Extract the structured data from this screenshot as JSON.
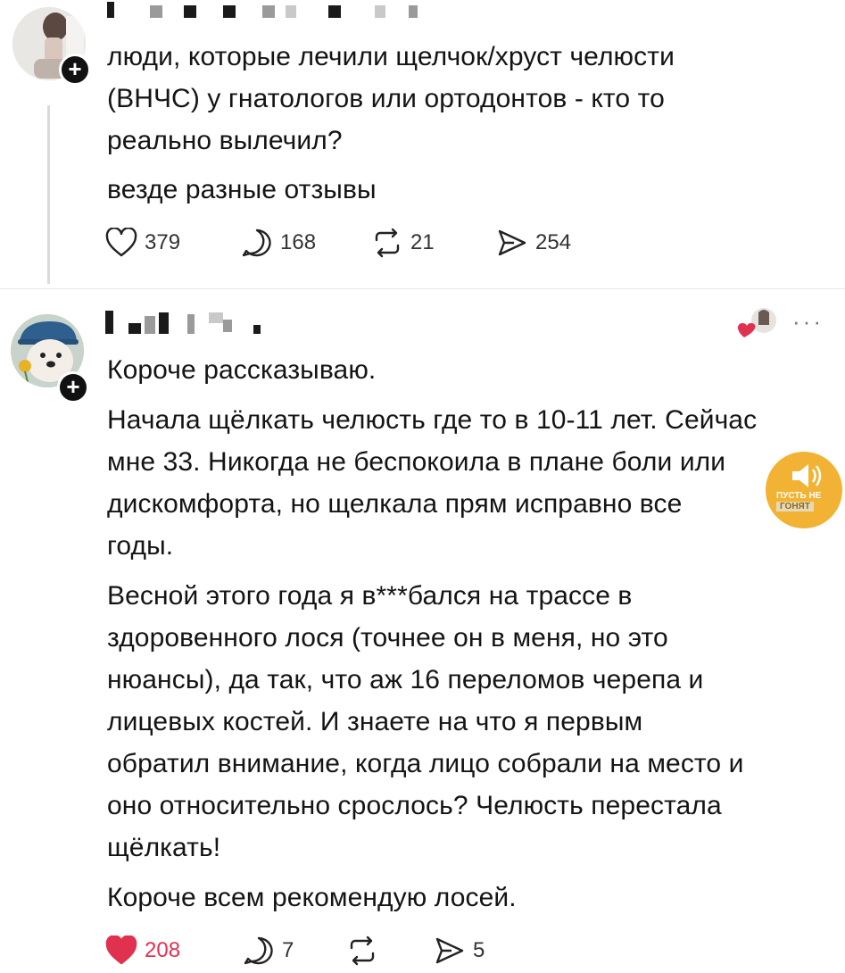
{
  "post": {
    "text_lines": [
      "люди, которые лечили щелчок/хруст челюсти",
      "(ВНЧС) у гнатологов или ортодонтов - кто то",
      "реально вылечил?"
    ],
    "subtext": "везде разные отзывы",
    "actions": {
      "likes": "379",
      "comments": "168",
      "reposts": "21",
      "shares": "254"
    }
  },
  "reply": {
    "paragraphs": [
      [
        "Короче рассказываю."
      ],
      [
        "Начала щёлкать челюсть где то в 10-11 лет. Сейчас",
        "мне 33. Никогда не беспокоила в плане боли или",
        "дискомфорта, но щелкала прям исправно все",
        "годы."
      ],
      [
        "Весной этого года я в***бался на трассе в",
        "здоровенного лося (точнее он в меня, но это",
        "нюансы), да так, что аж 16 переломов черепа и",
        "лицевых костей. И знаете на что я первым",
        "обратил внимание, когда лицо собрали на место и",
        "оно относительно срослось? Челюсть перестала",
        "щёлкать!"
      ],
      [
        "Короче всем рекомендую лосей."
      ]
    ],
    "more_label": "···",
    "actions": {
      "likes": "208",
      "comments": "7",
      "shares": "5"
    }
  },
  "watermark": {
    "line1": "ПУСТЬ НЕ",
    "line2": "ГОНЯТ"
  },
  "icons": {
    "heart": "heart-icon",
    "comment": "comment-icon",
    "repost": "repost-icon",
    "share": "share-icon",
    "plus": "follow-plus-icon",
    "more": "more-icon"
  },
  "colors": {
    "liked": "#e0314f",
    "text": "#141414",
    "muted": "#777777",
    "badge": "#f2b233"
  }
}
